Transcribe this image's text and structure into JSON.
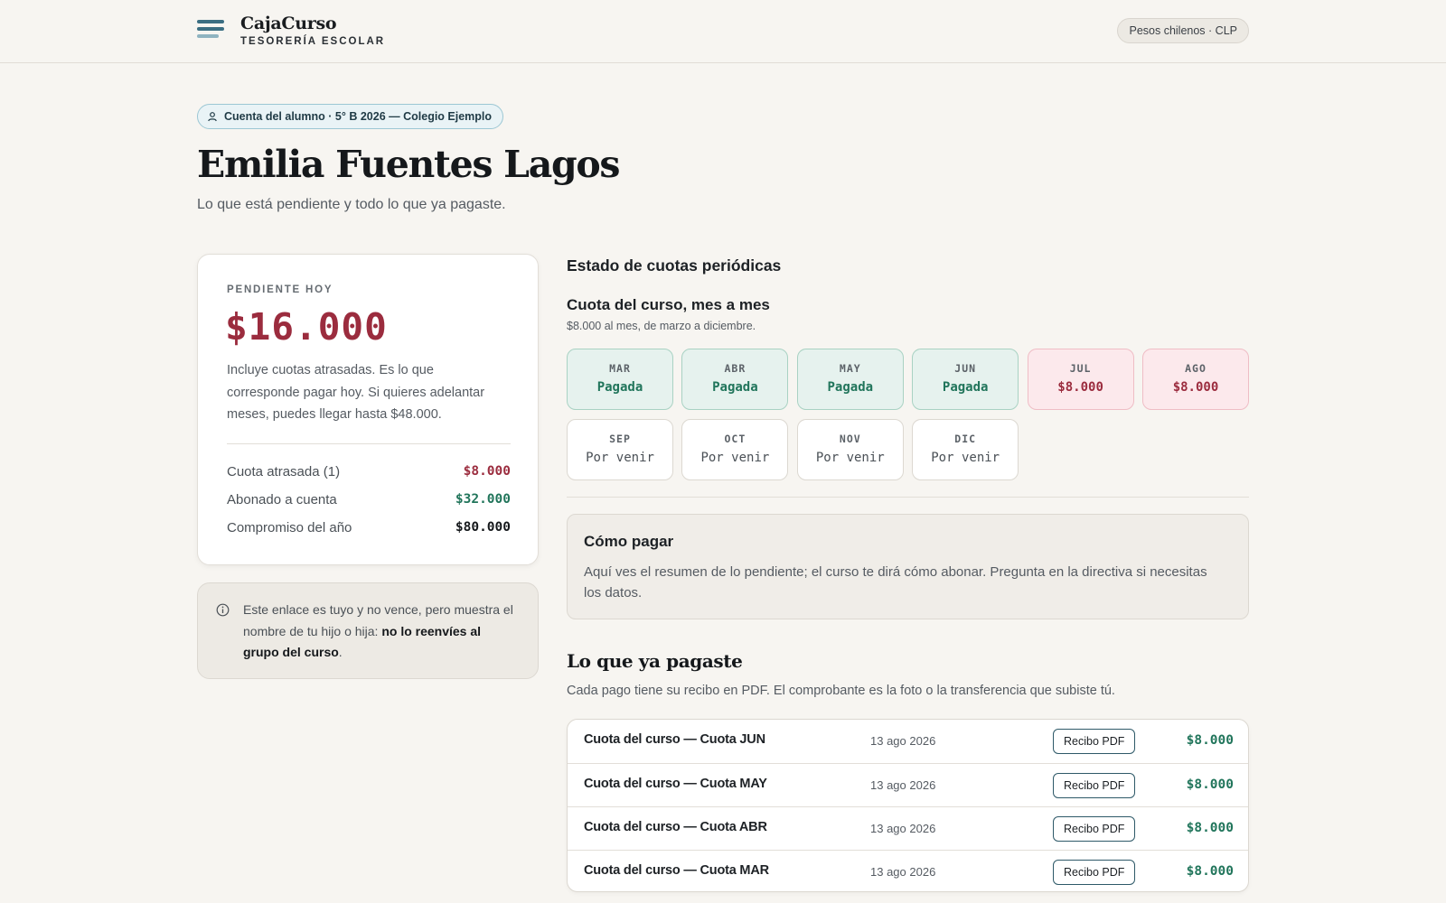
{
  "header": {
    "brand_name": "CajaCurso",
    "brand_sub": "TESORERÍA ESCOLAR",
    "currency": "Pesos chilenos · CLP"
  },
  "hero": {
    "account_chip": "Cuenta del alumno · 5° B 2026 — Colegio Ejemplo",
    "student_name": "Emilia Fuentes Lagos",
    "subtitle": "Lo que está pendiente y todo lo que ya pagaste."
  },
  "summary": {
    "kicker": "PENDIENTE HOY",
    "amount": "$16.000",
    "description": "Incluye cuotas atrasadas. Es lo que corresponde pagar hoy. Si quieres adelantar meses, puedes llegar hasta $48.000.",
    "rows": [
      {
        "label": "Cuota atrasada (1)",
        "value": "$8.000",
        "color": "#9b2c3e"
      },
      {
        "label": "Abonado a cuenta",
        "value": "$32.000",
        "color": "#21755b"
      },
      {
        "label": "Compromiso del año",
        "value": "$80.000",
        "color": "#15181b"
      }
    ]
  },
  "notice": {
    "text_before": "Este enlace es tuyo y no vence, pero muestra el nombre de tu hijo o hija: ",
    "text_bold": "no lo reenvíes al grupo del curso",
    "text_after": "."
  },
  "fees": {
    "section_title": "Estado de cuotas periódicas",
    "title": "Cuota del curso, mes a mes",
    "note": "$8.000 al mes, de marzo a diciembre.",
    "months": [
      {
        "month": "MAR",
        "status": "Pagada",
        "state": "paid"
      },
      {
        "month": "ABR",
        "status": "Pagada",
        "state": "paid"
      },
      {
        "month": "MAY",
        "status": "Pagada",
        "state": "paid"
      },
      {
        "month": "JUN",
        "status": "Pagada",
        "state": "paid"
      },
      {
        "month": "JUL",
        "status": "$8.000",
        "state": "due"
      },
      {
        "month": "AGO",
        "status": "$8.000",
        "state": "due"
      },
      {
        "month": "SEP",
        "status": "Por venir",
        "state": "future"
      },
      {
        "month": "OCT",
        "status": "Por venir",
        "state": "future"
      },
      {
        "month": "NOV",
        "status": "Por venir",
        "state": "future"
      },
      {
        "month": "DIC",
        "status": "Por venir",
        "state": "future"
      }
    ]
  },
  "howto": {
    "title": "Cómo pagar",
    "text": "Aquí ves el resumen de lo pendiente; el curso te dirá cómo abonar. Pregunta en la directiva si necesitas los datos."
  },
  "history": {
    "title": "Lo que ya pagaste",
    "note": "Cada pago tiene su recibo en PDF. El comprobante es la foto o la transferencia que subiste tú.",
    "rows": [
      {
        "concept": "Cuota del curso — Cuota JUN",
        "date": "13 ago 2026",
        "receipt_label": "Recibo PDF",
        "amount": "$8.000"
      },
      {
        "concept": "Cuota del curso — Cuota MAY",
        "date": "13 ago 2026",
        "receipt_label": "Recibo PDF",
        "amount": "$8.000"
      },
      {
        "concept": "Cuota del curso — Cuota ABR",
        "date": "13 ago 2026",
        "receipt_label": "Recibo PDF",
        "amount": "$8.000"
      },
      {
        "concept": "Cuota del curso — Cuota MAR",
        "date": "13 ago 2026",
        "receipt_label": "Recibo PDF",
        "amount": "$8.000"
      }
    ]
  }
}
